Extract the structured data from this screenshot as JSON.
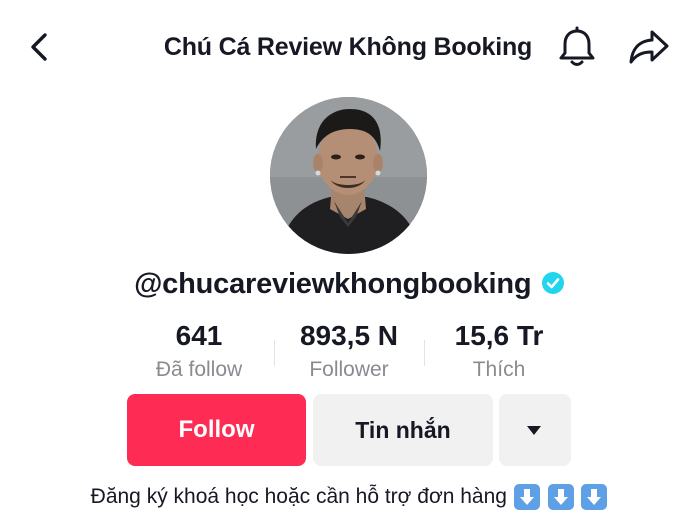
{
  "header": {
    "title": "Chú Cá Review Không Booking",
    "icons": [
      "back-arrow-icon",
      "bell-icon",
      "share-icon"
    ]
  },
  "profile": {
    "username": "@chucareviewkhongbooking",
    "verified": true,
    "verified_color": "#20d5ec"
  },
  "stats": [
    {
      "value": "641",
      "label": "Đã follow"
    },
    {
      "value": "893,5 N",
      "label": "Follower"
    },
    {
      "value": "15,6 Tr",
      "label": "Thích"
    }
  ],
  "actions": {
    "follow_label": "Follow",
    "message_label": "Tin nhắn",
    "more_icon": "caret-down-icon",
    "follow_color": "#fe2c55"
  },
  "bio": {
    "text": "Đăng ký khoá học hoặc cần hỗ trợ đơn hàng",
    "emoji": [
      "down-arrow-emoji",
      "down-arrow-emoji",
      "down-arrow-emoji"
    ]
  }
}
